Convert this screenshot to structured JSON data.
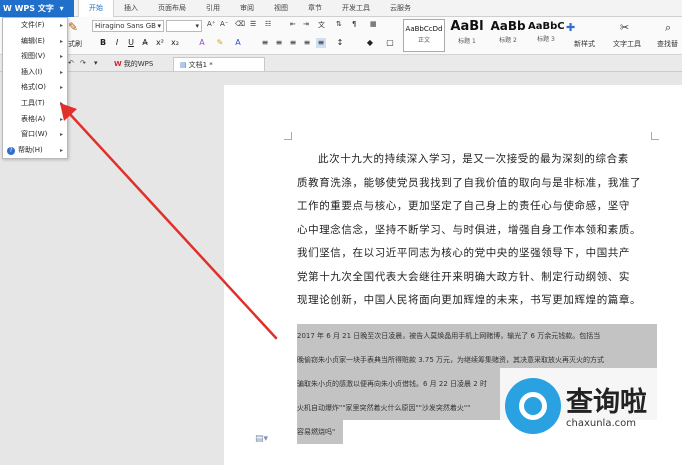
{
  "app": {
    "title": "WPS 文字"
  },
  "tabs": [
    "开始",
    "插入",
    "页面布局",
    "引用",
    "审阅",
    "视图",
    "章节",
    "开发工具",
    "云服务"
  ],
  "ribbon": {
    "font_name": "Hiragino Sans GB",
    "font_size": "",
    "format_painter": "式刷",
    "styles": [
      {
        "sample": "AaBbCcDd",
        "name": "正文"
      },
      {
        "sample": "AaBl",
        "name": "标题 1"
      },
      {
        "sample": "AaBb",
        "name": "标题 2"
      },
      {
        "sample": "AaBbC",
        "name": "标题 3"
      }
    ],
    "new_style": "新样式",
    "text_tools": "文字工具",
    "find_replace": "查找替"
  },
  "doc_tabs": {
    "wps": "我的WPS",
    "doc": "文档1 *"
  },
  "menu": {
    "items": [
      "文件(F)",
      "编辑(E)",
      "视图(V)",
      "插入(I)",
      "格式(O)",
      "工具(T)",
      "表格(A)",
      "窗口(W)",
      "帮助(H)"
    ]
  },
  "document": {
    "paragraph_lines": [
      "此次十九大的持续深入学习，是又一次接受的最为深刻的综合素",
      "质教育洗涤，能够使党员我找到了自我价值的取向与是非标准，我准了",
      "工作的重要点与核心，更加坚定了自己身上的责任心与使命感，坚守",
      "心中理念信念，坚持不断学习、与时俱进，增强自身工作本领和素质。",
      "我们坚信，在以习近平同志为核心的党中央的坚强领导下，中国共产",
      "党第十九次全国代表大会继往开来明确大政方针、制定行动纲领、实",
      "现理论创新，中国人民将面向更加辉煌的未来，书写更加辉煌的篇章。"
    ],
    "highlighted_lines": [
      "2017 年 6 月 21 日晚至次日凌晨，被告人莫焕晶用手机上网赌博，输光了 6 万余元钱款。包括当",
      "晚偷窃朱小贞家一块手表典当所得赃款 3.75 万元，为继续筹集赌资，其决意采取放火再灭火的方式",
      "骗取朱小贞的感激以便再向朱小贞借钱。6 月 22 日凌晨 2 时",
      "火机自动爆炸\"\"家里突然着火什么原因\"\"沙发突然着火\"\"",
      "容易燃烧吗\""
    ]
  },
  "watermark": {
    "title": "查询啦",
    "subtitle": "chaxunla.com"
  },
  "colors": {
    "accent": "#1f6fcb",
    "arrow": "#e0302a",
    "highlight": "#c3c3c3"
  }
}
